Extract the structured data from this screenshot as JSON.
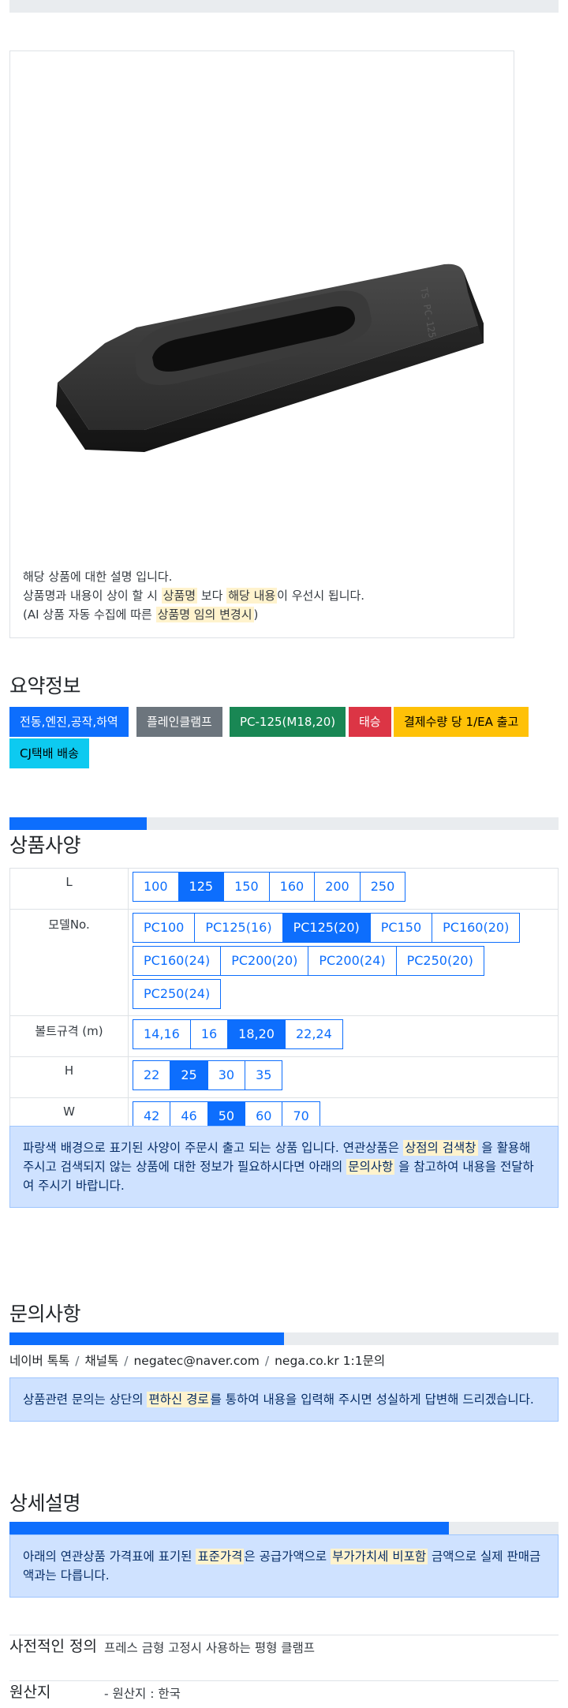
{
  "product": {
    "image_alt": "plain-clamp-product-image",
    "desc_line1": "해당 상품에 대한 설명 입니다.",
    "desc_line2_pre": "상품명과 내용이 상이 할 시 ",
    "desc_line2_mark1": "상품명",
    "desc_line2_mid": " 보다 ",
    "desc_line2_mark2": "해당 내용",
    "desc_line2_post": "이 우선시 됩니다.",
    "desc_line3_pre": "(AI 상품 자동 수집에 따른 ",
    "desc_line3_mark": "상품명 임의 변경시",
    "desc_line3_post": ")"
  },
  "summary": {
    "title": "요약정보",
    "tags": [
      {
        "label": "전동,엔진,공작,하역",
        "color": "#0d6efd",
        "text": "#ffffff"
      },
      {
        "label": "플레인클램프",
        "color": "#6c757d",
        "text": "#ffffff"
      },
      {
        "label": "PC-125(M18,20)",
        "color": "#198754",
        "text": "#ffffff"
      },
      {
        "label": "태승",
        "color": "#dc3545",
        "text": "#ffffff"
      },
      {
        "label": "결제수량 당 1/EA 출고",
        "color": "#ffc107",
        "text": "#000000"
      },
      {
        "label": "CJ택배 배송",
        "color": "#0dcaf0",
        "text": "#000000"
      }
    ]
  },
  "spec": {
    "title": "상품사양",
    "progress": 0.25,
    "rows": [
      {
        "label": "L",
        "options": [
          "100",
          "125",
          "150",
          "160",
          "200",
          "250"
        ],
        "selected": "125"
      },
      {
        "label": "모델No.",
        "options": [
          "PC100",
          "PC125(16)",
          "PC125(20)",
          "PC150",
          "PC160(20)",
          "PC160(24)",
          "PC200(20)",
          "PC200(24)",
          "PC250(20)",
          "PC250(24)"
        ],
        "selected": "PC125(20)"
      },
      {
        "label": "볼트규격 (m)",
        "options": [
          "14,16",
          "16",
          "18,20",
          "22,24"
        ],
        "selected": "18,20"
      },
      {
        "label": "H",
        "options": [
          "22",
          "25",
          "30",
          "35"
        ],
        "selected": "25"
      },
      {
        "label": "W",
        "options": [
          "42",
          "46",
          "50",
          "60",
          "70"
        ],
        "selected": "50"
      }
    ],
    "notice_pre": "파랑색 배경으로 표기된 사양이 주문시 출고 되는 상품 입니다. 연관상품은 ",
    "notice_mark1": "상점의 검색창",
    "notice_mid": " 을 활용해 주시고 검색되지 않는 상품에 대한 정보가 필요하시다면 아래의 ",
    "notice_mark2": "문의사항",
    "notice_post": " 을 참고하여 내용을 전달하여 주시기 바랍니다."
  },
  "inquiry": {
    "title": "문의사항",
    "progress": 0.5,
    "contacts": [
      "네이버 톡톡",
      "채널톡",
      "negatec@naver.com",
      "nega.co.kr 1:1문의"
    ],
    "separator": "/",
    "notice_pre": "상품관련 문의는 상단의 ",
    "notice_mark": "편하신 경로",
    "notice_post": "를 통하여 내용을 입력해 주시면 성실하게 답변해 드리겠습니다."
  },
  "detail": {
    "title": "상세설명",
    "progress": 0.8,
    "notice_pre": "아래의 연관상품 가격표에 표기된 ",
    "notice_mark1": "표준가격",
    "notice_mid": "은 공급가액으로 ",
    "notice_mark2": "부가가치세 비포함",
    "notice_post": " 금액으로 실제 판매금액과는 다릅니다.",
    "rows": [
      {
        "label": "사전적인 정의",
        "value": "프레스 금형 고정시 사용하는 평형 클램프"
      },
      {
        "label": "원산지",
        "value": "- 원산지 : 한국"
      }
    ]
  }
}
